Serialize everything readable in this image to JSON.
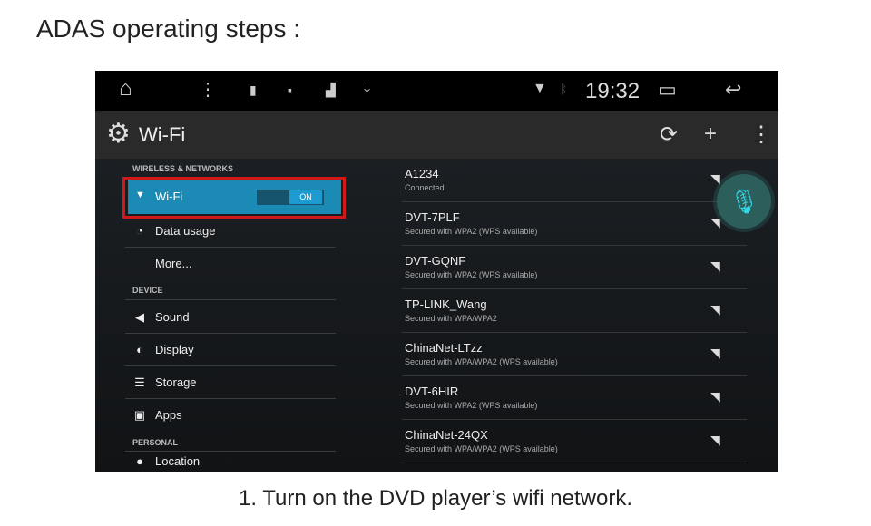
{
  "heading": "ADAS operating steps :",
  "caption": "1. Turn on the DVD player’s wifi network.",
  "status_bar": {
    "time": "19:32",
    "icons": [
      "home-icon",
      "menu-dots-icon",
      "usb-icon",
      "image-icon",
      "app-icon",
      "download-icon",
      "wifi-icon",
      "bluetooth-icon",
      "recent-apps-icon",
      "back-icon"
    ]
  },
  "action_bar": {
    "title": "Wi-Fi",
    "icons": [
      "settings-gear-icon",
      "wps-icon",
      "add-icon",
      "overflow-menu-icon"
    ]
  },
  "settings": {
    "wireless_header": "WIRELESS & NETWORKS",
    "wifi": {
      "label": "Wi-Fi",
      "toggle": "ON"
    },
    "data_usage": "Data usage",
    "more": "More...",
    "device_header": "DEVICE",
    "sound": "Sound",
    "display": "Display",
    "storage": "Storage",
    "apps": "Apps",
    "personal_header": "PERSONAL",
    "location": "Location"
  },
  "networks": [
    {
      "name": "A1234",
      "status": "Connected"
    },
    {
      "name": "DVT-7PLF",
      "status": "Secured with WPA2 (WPS available)"
    },
    {
      "name": "DVT-GQNF",
      "status": "Secured with WPA2 (WPS available)"
    },
    {
      "name": "TP-LINK_Wang",
      "status": "Secured with WPA/WPA2"
    },
    {
      "name": "ChinaNet-LTzz",
      "status": "Secured with WPA/WPA2 (WPS available)"
    },
    {
      "name": "DVT-6HIR",
      "status": "Secured with WPA2 (WPS available)"
    },
    {
      "name": "ChinaNet-24QX",
      "status": "Secured with WPA/WPA2 (WPS available)"
    }
  ],
  "colors": {
    "highlight": "#1b8ab5",
    "annotation": "#d21919",
    "mic": "#35d6e6"
  }
}
